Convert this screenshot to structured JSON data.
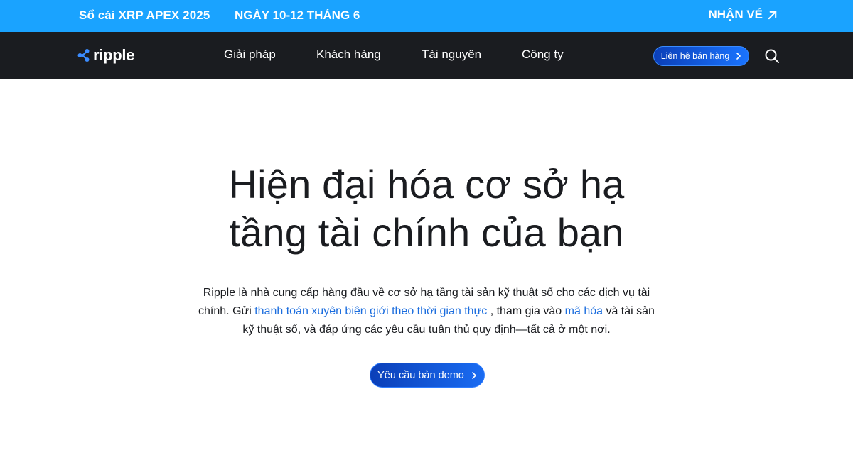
{
  "promo": {
    "event": "Sổ cái XRP APEX 2025",
    "date": "NGÀY 10-12 THÁNG 6",
    "cta": "NHẬN VÉ"
  },
  "nav": {
    "logo_text": "ripple",
    "items": [
      {
        "label": "Giải pháp"
      },
      {
        "label": "Khách hàng"
      },
      {
        "label": "Tài nguyên"
      },
      {
        "label": "Công ty"
      }
    ],
    "contact_label": "Liên hệ bán hàng"
  },
  "hero": {
    "title_line1": "Hiện đại hóa cơ sở hạ",
    "title_line2": "tầng tài chính của bạn",
    "text_1": "Ripple là nhà cung cấp hàng đầu về cơ sở hạ tầng tài sản kỹ thuật số cho các dịch vụ tài chính. Gửi ",
    "link_1": "thanh toán xuyên biên giới theo thời gian thực",
    "text_2": " , tham gia vào ",
    "link_2": "mã hóa",
    "text_3": " và tài sản kỹ thuật số, và đáp ứng các yêu cầu tuân thủ quy định—tất cả ở một nơi.",
    "cta_label": "Yêu cầu bản demo"
  },
  "colors": {
    "promo_bg": "#1aa3ff",
    "nav_bg": "#1a1c20",
    "accent": "#1b6dde",
    "button_gradient_start": "#0b3fb8",
    "button_gradient_end": "#1a74ff"
  },
  "icons": {
    "promo_cta": "arrow-up-right-icon",
    "logo": "ripple-logo-icon",
    "button_chevron": "chevron-right-icon",
    "search": "search-icon"
  }
}
